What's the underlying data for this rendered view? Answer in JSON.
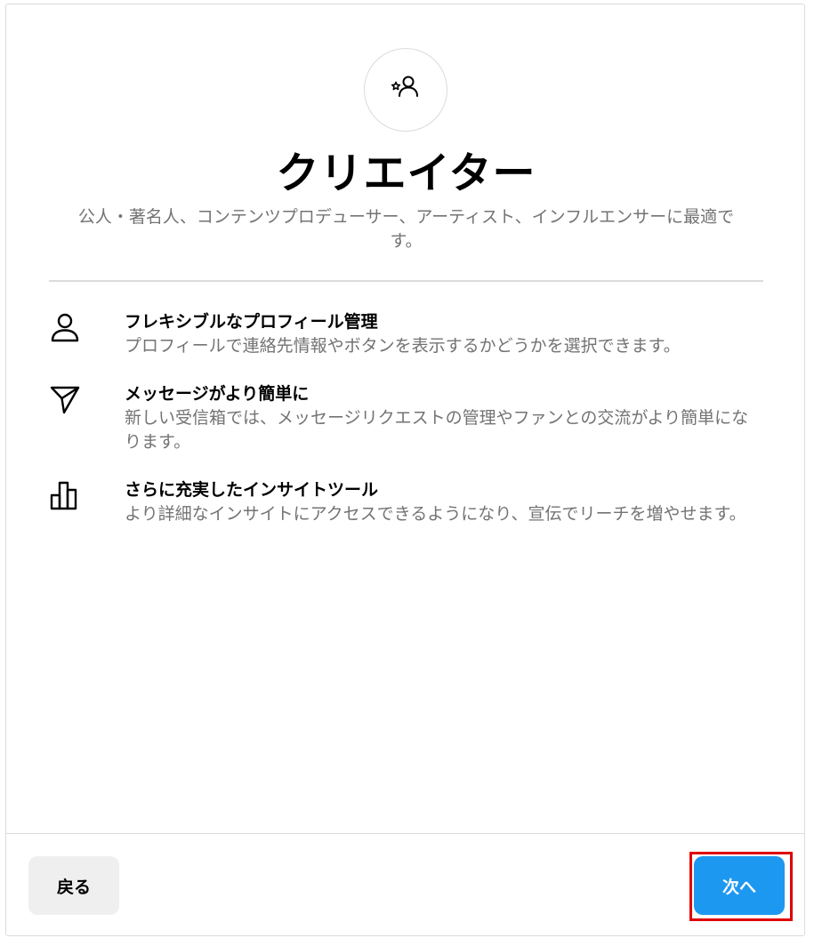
{
  "header": {
    "icon": "star-person-icon",
    "title": "クリエイター",
    "subtitle": "公人・著名人、コンテンツプロデューサー、アーティスト、インフルエンサーに最適です。"
  },
  "features": [
    {
      "icon": "person-icon",
      "title": "フレキシブルなプロフィール管理",
      "description": "プロフィールで連絡先情報やボタンを表示するかどうかを選択できます。"
    },
    {
      "icon": "paper-plane-icon",
      "title": "メッセージがより簡単に",
      "description": "新しい受信箱では、メッセージリクエストの管理やファンとの交流がより簡単になります。"
    },
    {
      "icon": "bar-chart-icon",
      "title": "さらに充実したインサイトツール",
      "description": "より詳細なインサイトにアクセスできるようになり、宣伝でリーチを増やせます。"
    }
  ],
  "footer": {
    "back_label": "戻る",
    "next_label": "次へ"
  },
  "colors": {
    "primary_button": "#1d98f0",
    "secondary_button": "#efefef",
    "muted_text": "#737373",
    "highlight": "#e00000"
  }
}
